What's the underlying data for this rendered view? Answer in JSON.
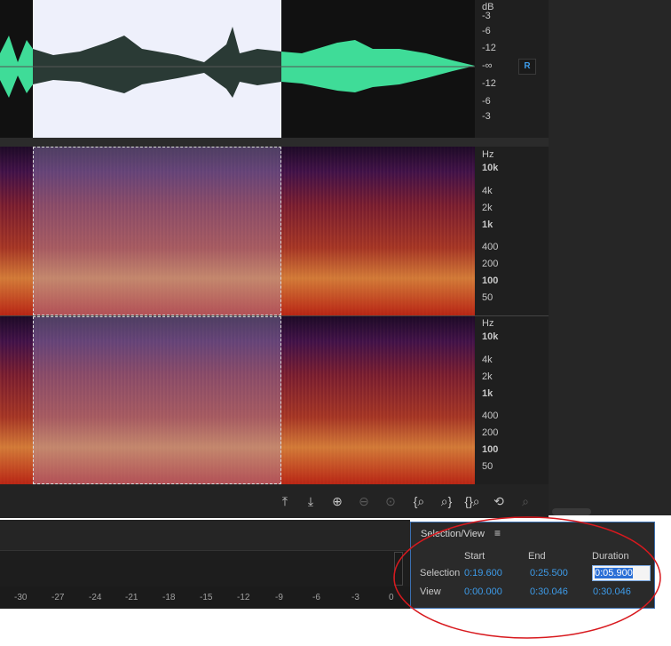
{
  "waveform": {
    "db_ticks": [
      "dB",
      "-3",
      "-6",
      "-12",
      "-∞",
      "-12",
      "-6",
      "-3"
    ],
    "channel_badge": "R"
  },
  "spectrogram_top": {
    "freq_ticks": [
      "Hz",
      "10k",
      "4k",
      "2k",
      "1k",
      "400",
      "200",
      "100",
      "50"
    ]
  },
  "spectrogram_bottom": {
    "freq_ticks": [
      "Hz",
      "10k",
      "4k",
      "2k",
      "1k",
      "400",
      "200",
      "100",
      "50"
    ]
  },
  "zoom_toolbar": {
    "icons": [
      "zoom-in-amplitude-icon",
      "zoom-out-amplitude-icon",
      "zoom-in-time-icon",
      "zoom-out-time-icon",
      "zoom-out-full-icon",
      "zoom-in-left-icon",
      "zoom-in-right-icon",
      "zoom-selection-icon",
      "zoom-reset-icon",
      "zoom-frequency-icon"
    ]
  },
  "timeline": {
    "ticks": [
      "-30",
      "-27",
      "-24",
      "-21",
      "-18",
      "-15",
      "-12",
      "-9",
      "-6",
      "-3",
      "0"
    ]
  },
  "selection_view": {
    "title": "Selection/View",
    "menu_icon": "≡",
    "columns": {
      "start": "Start",
      "end": "End",
      "duration": "Duration"
    },
    "selection": {
      "label": "Selection",
      "start": "0:19.600",
      "end": "0:25.500",
      "duration": "0:05.900"
    },
    "view": {
      "label": "View",
      "start": "0:00.000",
      "end": "0:30.046",
      "duration": "0:30.046"
    }
  },
  "colors": {
    "accent_blue": "#3d9be9",
    "waveform_green": "#3fdc98",
    "annotation_red": "#d8191e"
  }
}
